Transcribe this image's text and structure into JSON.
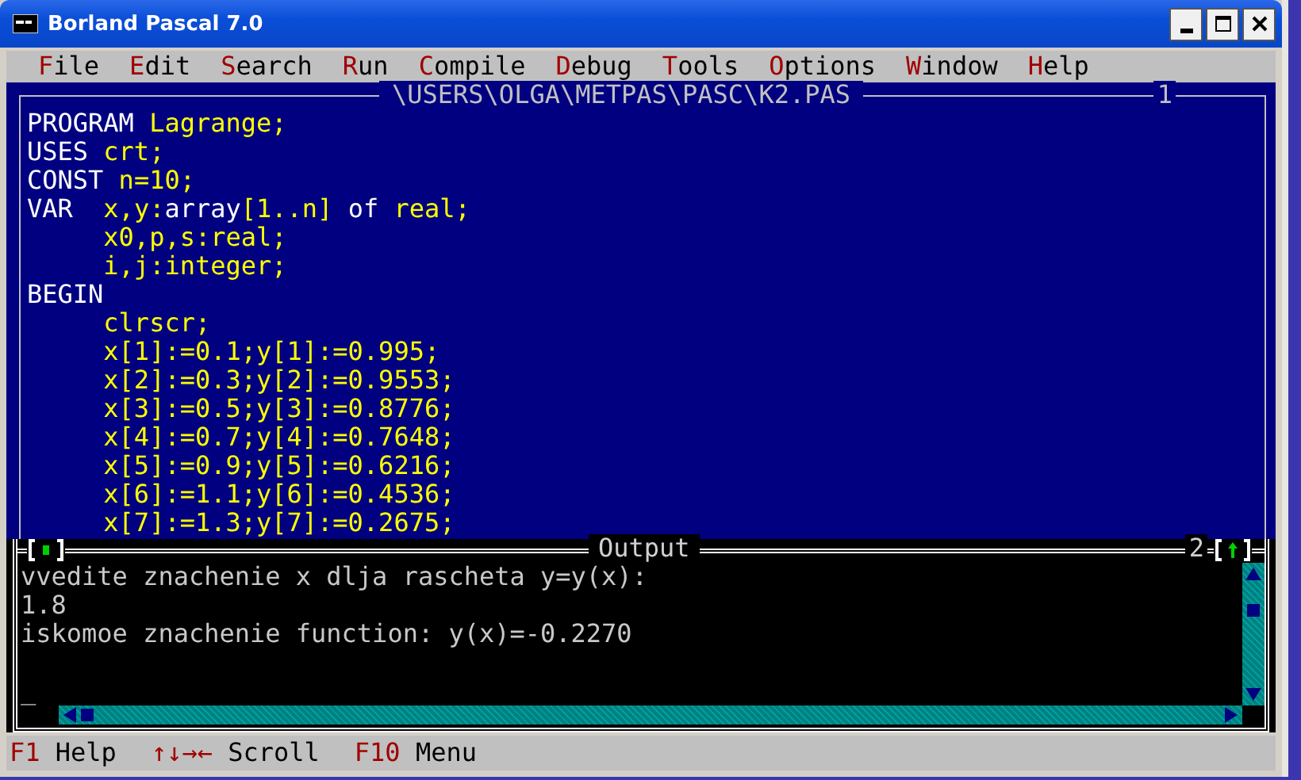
{
  "window": {
    "title": "Borland Pascal 7.0"
  },
  "menu": [
    {
      "hotkey": "F",
      "rest": "ile"
    },
    {
      "hotkey": "E",
      "rest": "dit"
    },
    {
      "hotkey": "S",
      "rest": "earch"
    },
    {
      "hotkey": "R",
      "rest": "un"
    },
    {
      "hotkey": "C",
      "rest": "ompile"
    },
    {
      "hotkey": "D",
      "rest": "ebug"
    },
    {
      "hotkey": "T",
      "rest": "ools"
    },
    {
      "hotkey": "O",
      "rest": "ptions"
    },
    {
      "hotkey": "W",
      "rest": "indow"
    },
    {
      "hotkey": "H",
      "rest": "elp"
    }
  ],
  "editor": {
    "title": "\\USERS\\OLGA\\METPAS\\PASC\\K2.PAS",
    "number": "1",
    "lines": [
      [
        {
          "kind": "keyword",
          "t": "PROGRAM"
        },
        {
          "kind": "code",
          "t": " Lagrange;"
        }
      ],
      [
        {
          "kind": "keyword",
          "t": "USES"
        },
        {
          "kind": "code",
          "t": " crt;"
        }
      ],
      [
        {
          "kind": "keyword",
          "t": "CONST"
        },
        {
          "kind": "code",
          "t": " n=10;"
        }
      ],
      [
        {
          "kind": "keyword",
          "t": "VAR"
        },
        {
          "kind": "code",
          "t": "  x,y:"
        },
        {
          "kind": "keyword",
          "t": "array"
        },
        {
          "kind": "code",
          "t": "[1..n] "
        },
        {
          "kind": "keyword",
          "t": "of"
        },
        {
          "kind": "code",
          "t": " real;"
        }
      ],
      [
        {
          "kind": "code",
          "t": "     x0,p,s:real;"
        }
      ],
      [
        {
          "kind": "code",
          "t": "     i,j:integer;"
        }
      ],
      [
        {
          "kind": "keyword",
          "t": "BEGIN"
        }
      ],
      [
        {
          "kind": "code",
          "t": "     clrscr;"
        }
      ],
      [
        {
          "kind": "code",
          "t": "     x[1]:=0.1;y[1]:=0.995;"
        }
      ],
      [
        {
          "kind": "code",
          "t": "     x[2]:=0.3;y[2]:=0.9553;"
        }
      ],
      [
        {
          "kind": "code",
          "t": "     x[3]:=0.5;y[3]:=0.8776;"
        }
      ],
      [
        {
          "kind": "code",
          "t": "     x[4]:=0.7;y[4]:=0.7648;"
        }
      ],
      [
        {
          "kind": "code",
          "t": "     x[5]:=0.9;y[5]:=0.6216;"
        }
      ],
      [
        {
          "kind": "code",
          "t": "     x[6]:=1.1;y[6]:=0.4536;"
        }
      ],
      [
        {
          "kind": "code",
          "t": "     x[7]:=1.3;y[7]:=0.2675;"
        }
      ]
    ]
  },
  "output": {
    "title": "Output",
    "number": "2",
    "lines": [
      "vvedite znachenie x dlja rascheta y=y(x):",
      "1.8",
      "iskomoe znachenie function: y(x)=-0.2270"
    ],
    "cursor": "_"
  },
  "status_bar": [
    {
      "key": "F1",
      "label": "Help"
    },
    {
      "key": "↑↓→←",
      "label": "Scroll"
    },
    {
      "key": "F10",
      "label": "Menu"
    }
  ]
}
